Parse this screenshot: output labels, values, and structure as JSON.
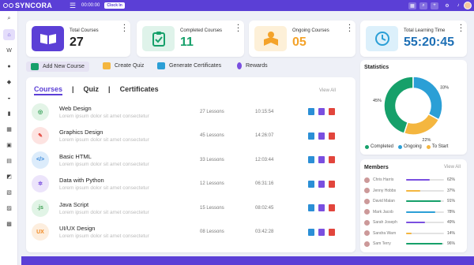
{
  "topbar": {
    "logo": "SYNCORA",
    "timer": "00:00:00",
    "clock_in": "Clock In",
    "menu_glyph": "☰"
  },
  "colors": {
    "brand": "#5b3fd6",
    "completed": "#16a06a",
    "ongoing": "#2b9fd6",
    "to_start": "#f4b63f"
  },
  "sidebar": {
    "items": [
      "⌕",
      "⌂",
      "W",
      "●",
      "◆",
      "◒",
      "▮",
      "▦",
      "▣",
      "▤",
      "◩",
      "▧",
      "▨",
      "▩"
    ]
  },
  "stats": [
    {
      "label": "Total Courses",
      "value": "27",
      "icon": "book-icon"
    },
    {
      "label": "Completed Courses",
      "value": "11",
      "icon": "clipboard-check-icon"
    },
    {
      "label": "Ongoing Courses",
      "value": "05",
      "icon": "reader-icon"
    },
    {
      "label": "Total Learning Time",
      "value": "55:20:45",
      "icon": "clock-icon"
    }
  ],
  "actions": [
    {
      "label": "Add New Course",
      "icon": "plus-icon"
    },
    {
      "label": "Create Quiz",
      "icon": "quiz-icon"
    },
    {
      "label": "Generate Certificates",
      "icon": "certificate-icon"
    },
    {
      "label": "Rewards",
      "icon": "medal-icon"
    }
  ],
  "tabs": {
    "courses": "Courses",
    "quiz": "Quiz",
    "certificates": "Certificates",
    "sep": "|"
  },
  "courses_view_all": "View All",
  "courses": [
    {
      "title": "Web Design",
      "desc": "Lorem ipsum dolor sit amet consectetur",
      "lessons": "27 Lessons",
      "duration": "10:15:54",
      "icon": "globe-icon",
      "glyph": "◎"
    },
    {
      "title": "Graphics Design",
      "desc": "Lorem ipsum dolor sit amet consectetur",
      "lessons": "45 Lessons",
      "duration": "14:26:07",
      "icon": "pen-tool-icon",
      "glyph": "✎"
    },
    {
      "title": "Basic HTML",
      "desc": "Lorem ipsum dolor sit amet consectetur",
      "lessons": "33 Lessons",
      "duration": "12:03:44",
      "icon": "code-icon",
      "glyph": "</>"
    },
    {
      "title": "Data with Python",
      "desc": "Lorem ipsum dolor sit amet consectetur",
      "lessons": "12 Lessons",
      "duration": "06:31:16",
      "icon": "python-icon",
      "glyph": "✲"
    },
    {
      "title": "Java Script",
      "desc": "Lorem ipsum dolor sit amet consectetur",
      "lessons": "15 Lessons",
      "duration": "08:02:45",
      "icon": "js-icon",
      "glyph": ".js"
    },
    {
      "title": "UI/UX Design",
      "desc": "Lorem ipsum dolor sit amet consectetur",
      "lessons": "08 Lessons",
      "duration": "03:42:28",
      "icon": "uiux-icon",
      "glyph": "UX"
    }
  ],
  "statistics": {
    "title": "Statistics",
    "slices": [
      {
        "name": "Completed",
        "value": 45,
        "label": "45%"
      },
      {
        "name": "Ongoing",
        "value": 33,
        "label": "33%"
      },
      {
        "name": "To Start",
        "value": 22,
        "label": "22%"
      }
    ]
  },
  "members": {
    "title": "Members",
    "view_all": "View All",
    "items": [
      {
        "name": "Chris Harris",
        "pct": 62,
        "label": "62%",
        "color": "#7a4fe0"
      },
      {
        "name": "Jenny Hobbs",
        "pct": 37,
        "label": "37%",
        "color": "#f4b63f"
      },
      {
        "name": "David Malan",
        "pct": 91,
        "label": "91%",
        "color": "#16a06a"
      },
      {
        "name": "Mark Jacob",
        "pct": 78,
        "label": "78%",
        "color": "#2b9fd6"
      },
      {
        "name": "Sarah Joseph",
        "pct": 49,
        "label": "49%",
        "color": "#7a4fe0"
      },
      {
        "name": "Sandra Warn",
        "pct": 14,
        "label": "14%",
        "color": "#f4b63f"
      },
      {
        "name": "Sam Terry",
        "pct": 96,
        "label": "96%",
        "color": "#16a06a"
      }
    ]
  }
}
